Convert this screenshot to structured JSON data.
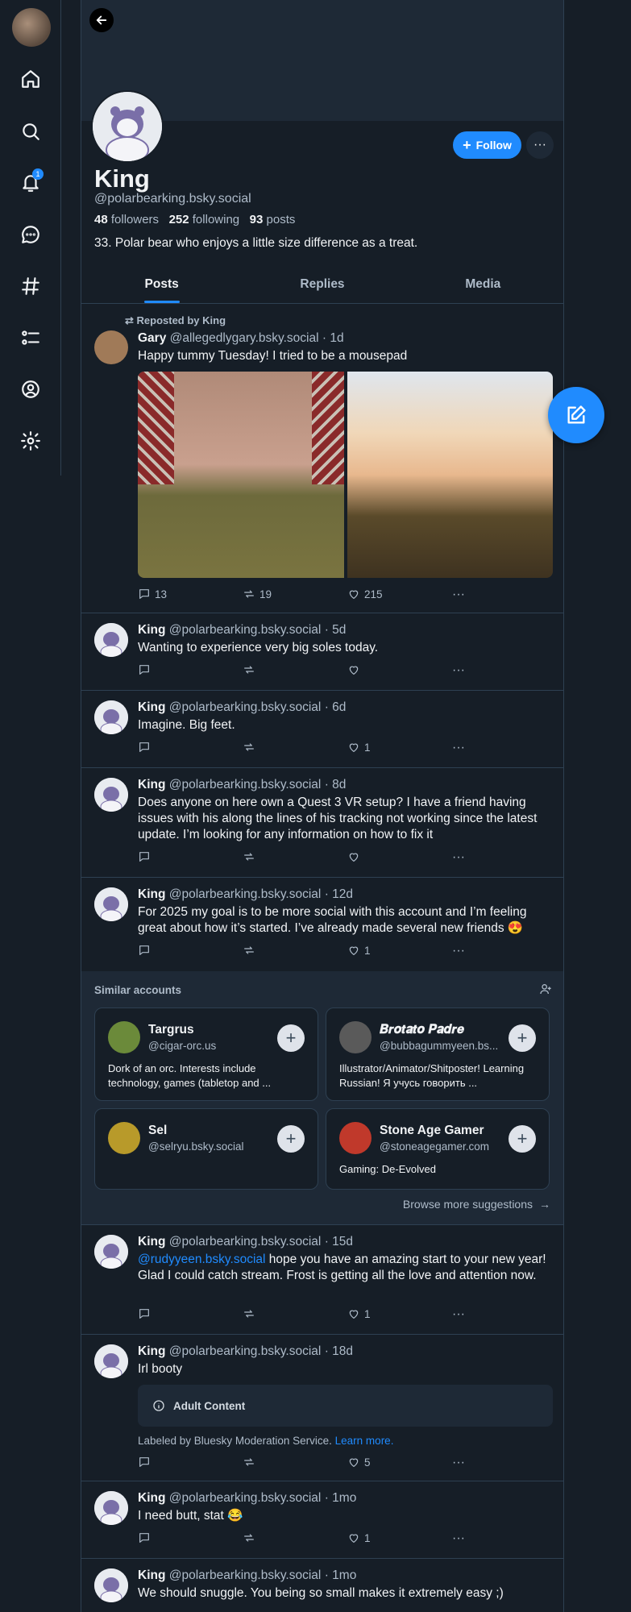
{
  "sidebar": {
    "notification_count": "1",
    "items": [
      "home",
      "search",
      "notifications",
      "chat",
      "feeds",
      "lists",
      "profile",
      "settings"
    ]
  },
  "profile": {
    "display_name": "King",
    "handle": "@polarbearking.bsky.social",
    "followers_count": "48",
    "followers_label": "followers",
    "following_count": "252",
    "following_label": "following",
    "posts_count": "93",
    "posts_label": "posts",
    "bio": "33. Polar bear who enjoys a little size difference as a treat.",
    "follow_label": "Follow",
    "more_label": "···"
  },
  "tabs": [
    "Posts",
    "Replies",
    "Media"
  ],
  "posts": [
    {
      "repost_label": "Reposted by King",
      "author": "Gary",
      "handle": "@allegedlygary.bsky.social",
      "time": "· 1d",
      "text": "Happy tummy Tuesday! I tried to be a mousepad",
      "replies": "13",
      "reposts": "19",
      "likes": "215"
    },
    {
      "author": "King",
      "handle": "@polarbearking.bsky.social",
      "time": "· 5d",
      "text": "Wanting to experience very big soles today.",
      "replies": "",
      "reposts": "",
      "likes": ""
    },
    {
      "author": "King",
      "handle": "@polarbearking.bsky.social",
      "time": "· 6d",
      "text": "Imagine. Big feet.",
      "replies": "",
      "reposts": "",
      "likes": "1"
    },
    {
      "author": "King",
      "handle": "@polarbearking.bsky.social",
      "time": "· 8d",
      "text": "Does anyone on here own a Quest 3 VR setup? I have a friend having issues with his along the lines of his tracking not working since the latest update. I’m looking for any information on how to fix it",
      "replies": "",
      "reposts": "",
      "likes": ""
    },
    {
      "author": "King",
      "handle": "@polarbearking.bsky.social",
      "time": "· 12d",
      "text": "For 2025 my goal is to be more social with this account and I’m feeling great about how it’s started. I’ve already made several new friends 😍",
      "replies": "",
      "reposts": "",
      "likes": "1"
    },
    {
      "author": "King",
      "handle": "@polarbearking.bsky.social",
      "time": "· 15d",
      "mention": "@rudyyeen.bsky.social",
      "text": " hope you have an amazing start to your new year! Glad I could catch stream. Frost is getting all the love and attention now.",
      "replies": "",
      "reposts": "",
      "likes": "1"
    },
    {
      "author": "King",
      "handle": "@polarbearking.bsky.social",
      "time": "· 18d",
      "text": "Irl booty",
      "warning": "Adult Content",
      "label_text": "Labeled by Bluesky Moderation Service.",
      "learn_more": "Learn more.",
      "replies": "",
      "reposts": "",
      "likes": "5"
    },
    {
      "author": "King",
      "handle": "@polarbearking.bsky.social",
      "time": "· 1mo",
      "text": "I need butt, stat 😂",
      "replies": "",
      "reposts": "",
      "likes": "1"
    },
    {
      "author": "King",
      "handle": "@polarbearking.bsky.social",
      "time": "· 1mo",
      "text": "We should snuggle. You being so small makes it extremely easy ;)"
    }
  ],
  "similar": {
    "title": "Similar accounts",
    "browse_label": "Browse more suggestions",
    "accounts": [
      {
        "name": "Targrus",
        "handle": "@cigar-orc.us",
        "desc": "Dork of an orc. Interests include technology, games (tabletop and ...",
        "color": "#6b8a3a"
      },
      {
        "name": "𝑩𝒓𝒐𝒕𝒂𝒕𝒐 𝑷𝒂𝒅𝒓𝒆",
        "handle": "@bubbagummyeen.bs...",
        "desc": "Illustrator/Animator/Shitposter! Learning Russian! Я учусь говорить ...",
        "color": "#5a5a5a"
      },
      {
        "name": "Sel",
        "handle": "@selryu.bsky.social",
        "desc": "",
        "color": "#b89a2a"
      },
      {
        "name": "Stone Age Gamer",
        "handle": "@stoneagegamer.com",
        "desc": "Gaming: De-Evolved",
        "color": "#c0392b"
      }
    ]
  },
  "colors": {
    "accent": "#208bfe",
    "background": "#161e27",
    "card": "#1e2936"
  }
}
